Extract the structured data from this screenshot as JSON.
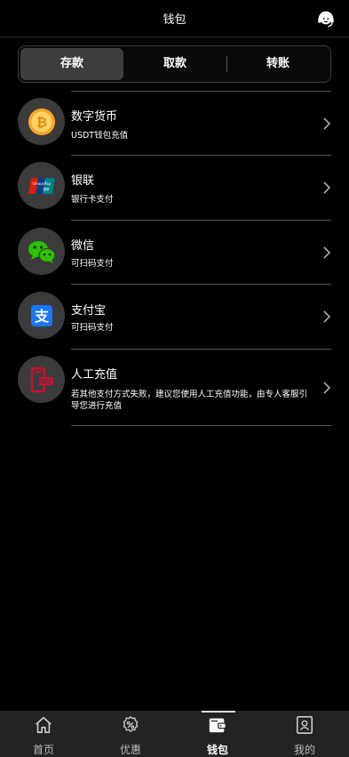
{
  "header": {
    "title": "钱包",
    "support_icon": "customer-service-icon"
  },
  "tabs": [
    {
      "label": "存款",
      "active": true
    },
    {
      "label": "取款",
      "active": false
    },
    {
      "label": "转账",
      "active": false
    }
  ],
  "methods": [
    {
      "name": "数字货币",
      "desc": "USDT钱包充值",
      "icon": "bitcoin-icon"
    },
    {
      "name": "银联",
      "desc": "银行卡支付",
      "icon": "unionpay-icon"
    },
    {
      "name": "微信",
      "desc": "可扫码支付",
      "icon": "wechat-icon"
    },
    {
      "name": "支付宝",
      "desc": "可扫码支付",
      "icon": "alipay-icon"
    },
    {
      "name": "人工充值",
      "desc": "若其他支付方式失败，建议您使用人工充值功能，由专人客服引导您进行充值",
      "icon": "manual-deposit-icon"
    }
  ],
  "unionpay_text": "UnionPay 银联",
  "alipay_glyph": "支",
  "bottom_nav": [
    {
      "label": "首页",
      "icon": "home-icon",
      "active": false
    },
    {
      "label": "优惠",
      "icon": "discount-icon",
      "active": false
    },
    {
      "label": "钱包",
      "icon": "wallet-icon",
      "active": true
    },
    {
      "label": "我的",
      "icon": "profile-icon",
      "active": false
    }
  ],
  "colors": {
    "background": "#000000",
    "segment_active": "#3d3d3d",
    "tabbar": "#232323",
    "bitcoin": "#f7a823",
    "wechat": "#2dc100",
    "alipay": "#1677ff",
    "manual": "#c8102e"
  }
}
